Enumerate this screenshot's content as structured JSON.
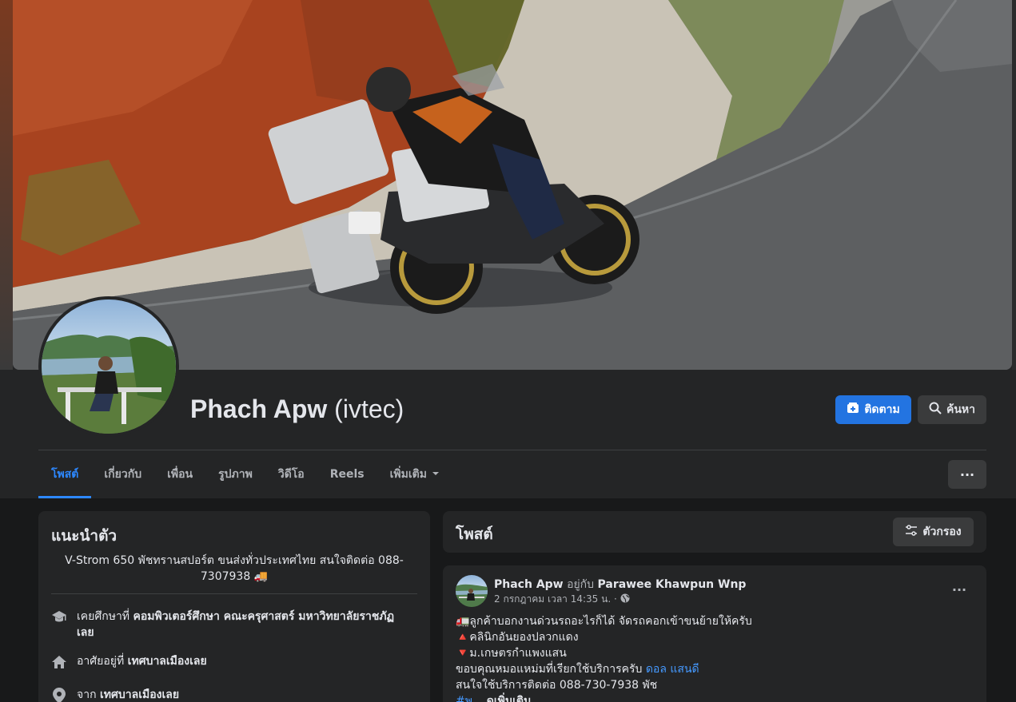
{
  "profile": {
    "name": "Phach Apw",
    "alternate_name": "(ivtec)"
  },
  "actions": {
    "follow_label": "ติดตาม",
    "search_label": "ค้นหา",
    "more_label": "···"
  },
  "tabs": [
    {
      "label": "โพสต์",
      "active": true
    },
    {
      "label": "เกี่ยวกับ"
    },
    {
      "label": "เพื่อน"
    },
    {
      "label": "รูปภาพ"
    },
    {
      "label": "วิดีโอ"
    },
    {
      "label": "Reels"
    },
    {
      "label": "เพิ่มเติม"
    }
  ],
  "intro": {
    "title": "แนะนำตัว",
    "bio": "V-Strom 650 พัชทรานสปอร์ต ขนส่งทั่วประเทศไทย สนใจติดต่อ 088-7307938 🚚",
    "education_prefix": "เคยศึกษาที่",
    "education": "คอมพิวเตอร์ศึกษา คณะครุศาสตร์ มหาวิทยาลัยราชภัฏเลย",
    "lives_prefix": "อาศัยอยู่ที่",
    "lives": "เทศบาลเมืองเลย",
    "from_prefix": "จาก",
    "from": "เทศบาลเมืองเลย"
  },
  "posts_section": {
    "title": "โพสต์",
    "filter_label": "ตัวกรอง"
  },
  "post": {
    "author": "Phach Apw",
    "with_text": "อยู่กับ",
    "with_person": "Parawee Khawpun Wnp",
    "timestamp": "2 กรกฎาคม เวลา 14:35 น. ·",
    "lines": [
      "🚛ลูกค้าบอกงานด่วนรถอะไรก็ได้ จัดรถคอกเข้าขนย้ายให้ครับ",
      "🔺คลินิกอันยองปลวกแดง",
      "🔻ม.เกษตรกำแพงแสน"
    ],
    "thanks_text": "ขอบคุณหมอแหม่มที่เรียกใช้บริการครับ",
    "thanks_link": "ดอล แสนดี",
    "contact_line": "สนใจใช้บริการติดต่อ 088-730-7938 พัช",
    "hashtag": "#พ...",
    "see_more": "ดูเพิ่มเติม"
  },
  "colors": {
    "accent": "#2374e1",
    "link": "#4599ff",
    "card_bg": "#242526",
    "page_bg": "#18191a"
  }
}
